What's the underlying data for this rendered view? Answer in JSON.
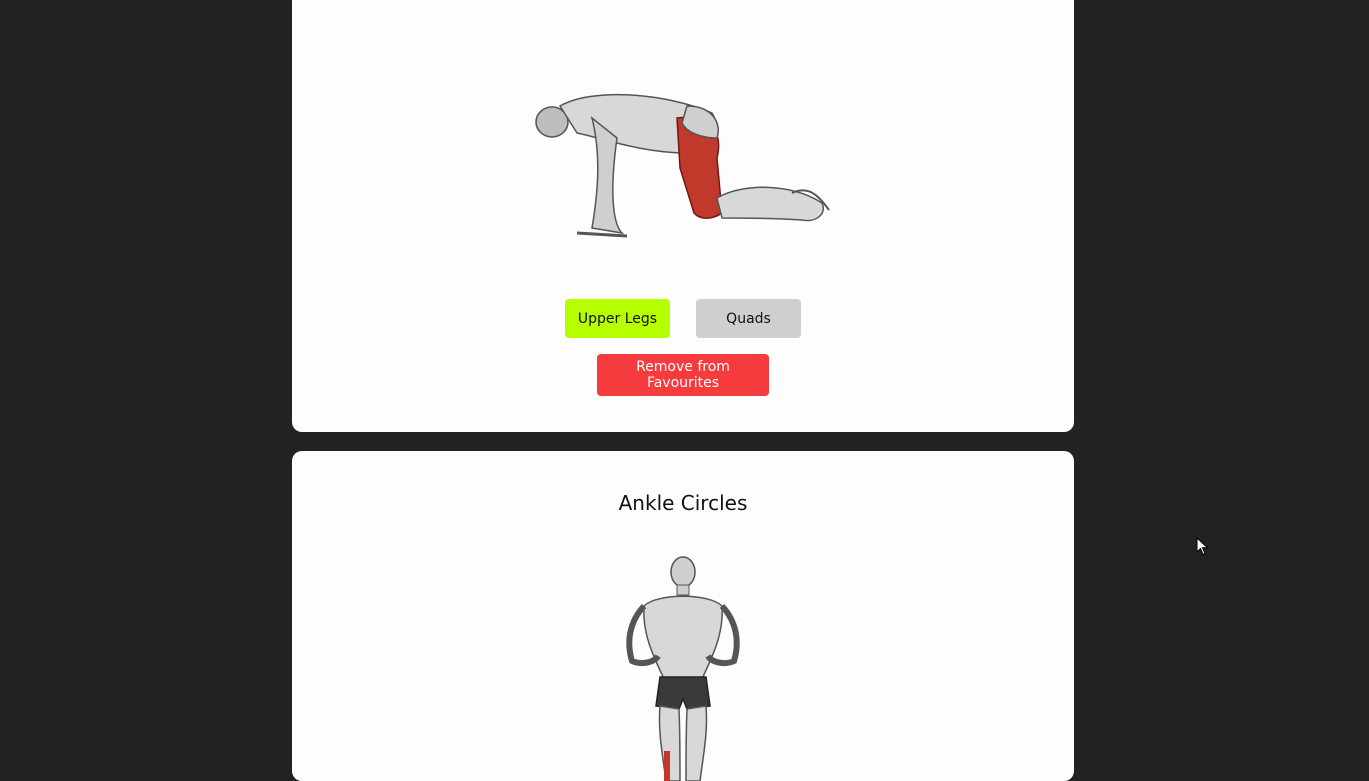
{
  "exercises": [
    {
      "title": "",
      "image_icon": "kneeling-exercise-figure",
      "tags": {
        "body_part": "Upper Legs",
        "target": "Quads"
      },
      "favourite_button_label": "Remove from Favourites"
    },
    {
      "title": "Ankle Circles",
      "image_icon": "standing-exercise-figure"
    }
  ],
  "colors": {
    "page_background": "#222222",
    "card_background": "#fdfdfd",
    "body_part_tag": "#b6ff00",
    "target_tag": "#cfcfcf",
    "favourite_button": "#f63b3e",
    "highlight_muscle": "#c0392b"
  },
  "cursor_icon": "mouse-pointer-icon"
}
